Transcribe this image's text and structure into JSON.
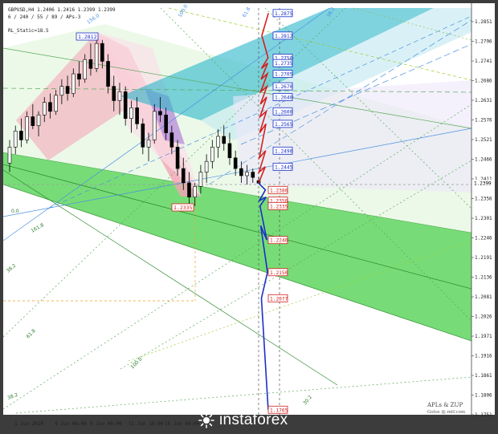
{
  "header": {
    "symbol_line": "GBPUSD,H4  1.2406 1.2416 1.2399 1.2399",
    "indicator_line": "6 / 240 / 55 / 89 / APs-3",
    "static_label": "RL_Static=18.5"
  },
  "branding": {
    "apls": "APLs & ZUP",
    "email": "Golos @ mtf.com",
    "logo_text": "instaforex"
  },
  "y_ticks": [
    "1.2851",
    "1.2796",
    "1.2741",
    "1.2686",
    "1.2631",
    "1.2576",
    "1.2521",
    "1.2466",
    "1.2411",
    "1.2356",
    "1.2301",
    "1.2246",
    "1.2191",
    "1.2136",
    "1.2081",
    "1.2026",
    "1.1971",
    "1.1916",
    "1.1861",
    "1.1806",
    "1.1751"
  ],
  "current_price": "1.2399",
  "x_ticks": [
    "1 Jun 2020",
    "4 Jun 08:00",
    "9 Jun 00:00",
    "11 Jun 16:00",
    "16 Jun 08:00"
  ],
  "pivot_labels": {
    "high": "1.2812",
    "low": "1.2335"
  },
  "up_targets": [
    "1.2875",
    "1.2812",
    "1.2750",
    "1.2735",
    "1.2705",
    "1.2670",
    "1.2640",
    "1.2600",
    "1.2565",
    "1.2490",
    "1.2445"
  ],
  "down_targets": [
    "1.2380",
    "1.2350",
    "1.2335",
    "1.2240",
    "1.2150",
    "1.2077",
    "1.1765"
  ],
  "fork_labels": [
    "156.0",
    "100.0",
    "61.8",
    "38.2",
    "0.0",
    "61.8",
    "100.0",
    "38.2",
    "161.8",
    "38.2",
    "30.2"
  ],
  "chart_data": {
    "type": "candlestick",
    "symbol": "GBPUSD",
    "timeframe": "H4",
    "ylim": [
      1.1751,
      1.2851
    ],
    "ohlc": [
      [
        1.2455,
        1.252,
        1.243,
        1.25
      ],
      [
        1.25,
        1.256,
        1.248,
        1.2545
      ],
      [
        1.2545,
        1.258,
        1.25,
        1.252
      ],
      [
        1.252,
        1.26,
        1.251,
        1.2585
      ],
      [
        1.2585,
        1.262,
        1.255,
        1.256
      ],
      [
        1.256,
        1.26,
        1.253,
        1.259
      ],
      [
        1.259,
        1.264,
        1.257,
        1.2625
      ],
      [
        1.2625,
        1.265,
        1.258,
        1.26
      ],
      [
        1.26,
        1.266,
        1.259,
        1.2645
      ],
      [
        1.2645,
        1.269,
        1.262,
        1.267
      ],
      [
        1.267,
        1.27,
        1.263,
        1.265
      ],
      [
        1.265,
        1.272,
        1.264,
        1.2705
      ],
      [
        1.2705,
        1.274,
        1.267,
        1.269
      ],
      [
        1.269,
        1.276,
        1.268,
        1.2745
      ],
      [
        1.2745,
        1.279,
        1.27,
        1.272
      ],
      [
        1.272,
        1.2812,
        1.271,
        1.279
      ],
      [
        1.279,
        1.28,
        1.272,
        1.274
      ],
      [
        1.274,
        1.276,
        1.265,
        1.267
      ],
      [
        1.267,
        1.27,
        1.26,
        1.263
      ],
      [
        1.263,
        1.268,
        1.259,
        1.2655
      ],
      [
        1.2655,
        1.267,
        1.256,
        1.258
      ],
      [
        1.258,
        1.263,
        1.254,
        1.261
      ],
      [
        1.261,
        1.264,
        1.255,
        1.2565
      ],
      [
        1.2565,
        1.258,
        1.248,
        1.25
      ],
      [
        1.25,
        1.254,
        1.246,
        1.252
      ],
      [
        1.252,
        1.262,
        1.251,
        1.26
      ],
      [
        1.26,
        1.264,
        1.257,
        1.259
      ],
      [
        1.259,
        1.261,
        1.252,
        1.254
      ],
      [
        1.254,
        1.256,
        1.248,
        1.25
      ],
      [
        1.25,
        1.252,
        1.242,
        1.244
      ],
      [
        1.244,
        1.247,
        1.238,
        1.24
      ],
      [
        1.24,
        1.243,
        1.234,
        1.236
      ],
      [
        1.236,
        1.24,
        1.2335,
        1.239
      ],
      [
        1.239,
        1.245,
        1.237,
        1.243
      ],
      [
        1.243,
        1.248,
        1.24,
        1.246
      ],
      [
        1.246,
        1.252,
        1.244,
        1.25
      ],
      [
        1.25,
        1.255,
        1.247,
        1.253
      ],
      [
        1.253,
        1.256,
        1.249,
        1.251
      ],
      [
        1.251,
        1.254,
        1.245,
        1.247
      ],
      [
        1.247,
        1.249,
        1.242,
        1.244
      ],
      [
        1.244,
        1.246,
        1.24,
        1.242
      ],
      [
        1.242,
        1.245,
        1.2395,
        1.243
      ],
      [
        1.243,
        1.244,
        1.24,
        1.2415
      ],
      [
        1.2406,
        1.2416,
        1.2399,
        1.2399
      ]
    ],
    "projection_up": [
      1.2399,
      1.2445,
      1.243,
      1.249,
      1.247,
      1.2565,
      1.254,
      1.26,
      1.2585,
      1.264,
      1.262,
      1.267,
      1.2655,
      1.2705,
      1.269,
      1.2735,
      1.272,
      1.275,
      1.2812,
      1.2875
    ],
    "projection_down": [
      1.2399,
      1.238,
      1.235,
      1.236,
      1.2335,
      1.224,
      1.228,
      1.215,
      1.2077,
      1.1765
    ],
    "colors": {
      "up": "#d42020",
      "down": "#1a2fc8",
      "fill_green": "#5fd65f",
      "fill_teal": "#29b6c9",
      "fill_pink": "#f5a3b5",
      "fill_violet": "#b089d9",
      "bg": "#ffffff"
    }
  }
}
